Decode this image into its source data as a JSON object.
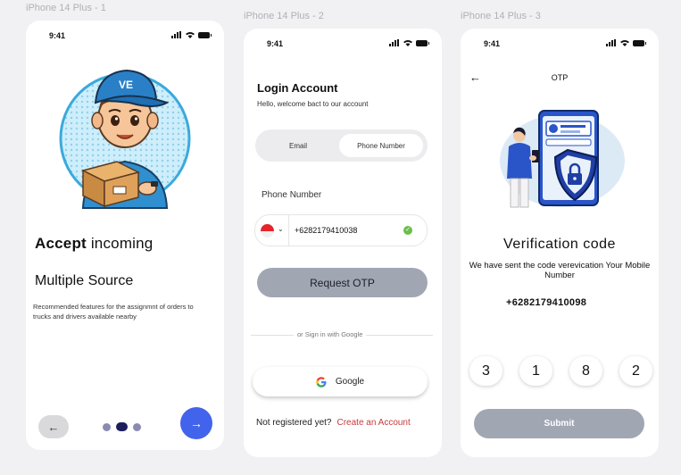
{
  "frames": {
    "frame1": "iPhone 14 Plus - 1",
    "frame2": "iPhone 14 Plus - 2",
    "frame3": "iPhone 14 Plus - 3"
  },
  "status_time": "9:41",
  "screen1": {
    "headline_bold": "Accept",
    "headline_rest": "incoming",
    "headline2": "Multiple Source",
    "description": "Recommended features for the assignmnt of orders to trucks and drivers available nearby",
    "back_icon": "arrow-left-icon",
    "next_icon": "arrow-right-icon",
    "page_indicator": {
      "total": 3,
      "active": 2
    },
    "colors": {
      "next": "#4263eb",
      "dot_active": "#1d1f5c",
      "dot": "#8a8ab2"
    }
  },
  "screen2": {
    "title": "Login Account",
    "subtitle": "Hello, welcome bact to our account",
    "tabs": [
      {
        "label": "Email",
        "selected": false
      },
      {
        "label": "Phone Number",
        "selected": true
      }
    ],
    "phone_label": "Phone Number",
    "phone_value": "+6282179410038",
    "request_label": "Request OTP",
    "or_text": "or Sign in with Google",
    "google_label": "Google",
    "not_registered": "Not registered yet?",
    "create_account": "Create an Account",
    "colors": {
      "link": "#c83a3a",
      "button": "#a1a6b3",
      "valid": "#6bbf4a"
    }
  },
  "screen3": {
    "header_title": "OTP",
    "title": "Verification code",
    "subtitle": "We have sent the code verevication Your Mobile Number",
    "phone": "+6282179410098",
    "otp_digits": [
      "3",
      "1",
      "8",
      "2"
    ],
    "submit_label": "Submit"
  }
}
